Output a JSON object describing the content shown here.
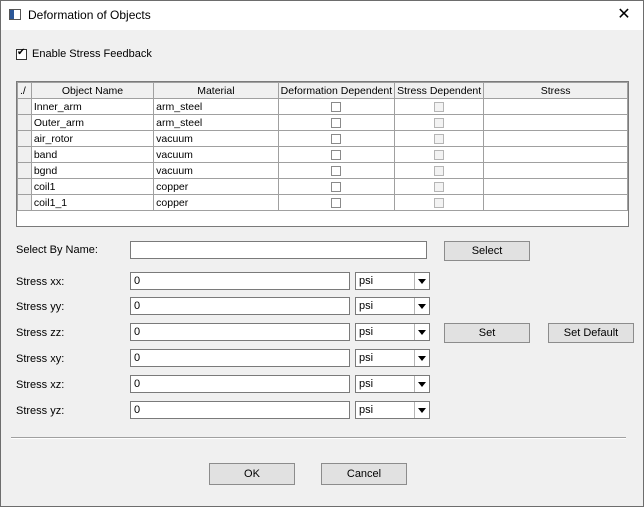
{
  "window": {
    "title": "Deformation of Objects",
    "icon": "app-window-icon",
    "close": "✕"
  },
  "enable_stress_feedback": {
    "label": "Enable Stress Feedback",
    "checked": true
  },
  "table": {
    "corner": "./",
    "columns": [
      "Object Name",
      "Material",
      "Deformation Dependent",
      "Stress Dependent",
      "Stress"
    ],
    "rows": [
      {
        "name": "Inner_arm",
        "material": "arm_steel",
        "stress": ""
      },
      {
        "name": "Outer_arm",
        "material": "arm_steel",
        "stress": ""
      },
      {
        "name": "air_rotor",
        "material": "vacuum",
        "stress": ""
      },
      {
        "name": "band",
        "material": "vacuum",
        "stress": ""
      },
      {
        "name": "bgnd",
        "material": "vacuum",
        "stress": ""
      },
      {
        "name": "coil1",
        "material": "copper",
        "stress": ""
      },
      {
        "name": "coil1_1",
        "material": "copper",
        "stress": ""
      }
    ]
  },
  "select_by_name": {
    "label": "Select By Name:",
    "value": "",
    "button": "Select"
  },
  "stress_fields": [
    {
      "label": "Stress xx:",
      "value": "0",
      "unit": "psi"
    },
    {
      "label": "Stress yy:",
      "value": "0",
      "unit": "psi"
    },
    {
      "label": "Stress zz:",
      "value": "0",
      "unit": "psi"
    },
    {
      "label": "Stress xy:",
      "value": "0",
      "unit": "psi"
    },
    {
      "label": "Stress xz:",
      "value": "0",
      "unit": "psi"
    },
    {
      "label": "Stress yz:",
      "value": "0",
      "unit": "psi"
    }
  ],
  "buttons": {
    "set": "Set",
    "set_default": "Set Default",
    "ok": "OK",
    "cancel": "Cancel"
  }
}
